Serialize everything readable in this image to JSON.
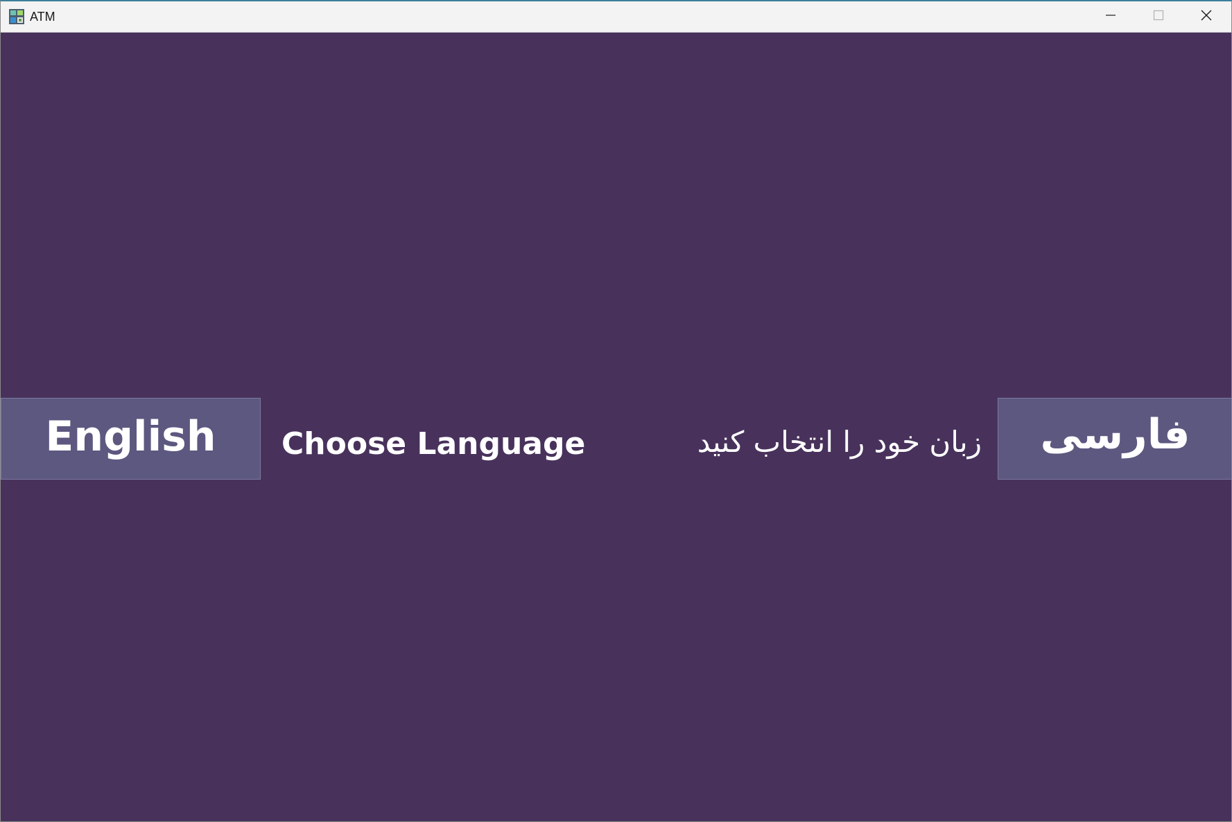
{
  "window": {
    "title": "ATM",
    "icon": "atm-app-icon"
  },
  "titlebar_buttons": {
    "minimize_icon": "minimize-icon",
    "maximize_icon": "maximize-icon",
    "close_icon": "close-icon"
  },
  "language_screen": {
    "english_button": "English",
    "english_prompt": "Choose Language",
    "farsi_prompt": "زبان خود را انتخاب کنید",
    "farsi_button": "فارسی"
  },
  "colors": {
    "background": "#48325c",
    "button": "#5c5880",
    "text": "#ffffff"
  }
}
